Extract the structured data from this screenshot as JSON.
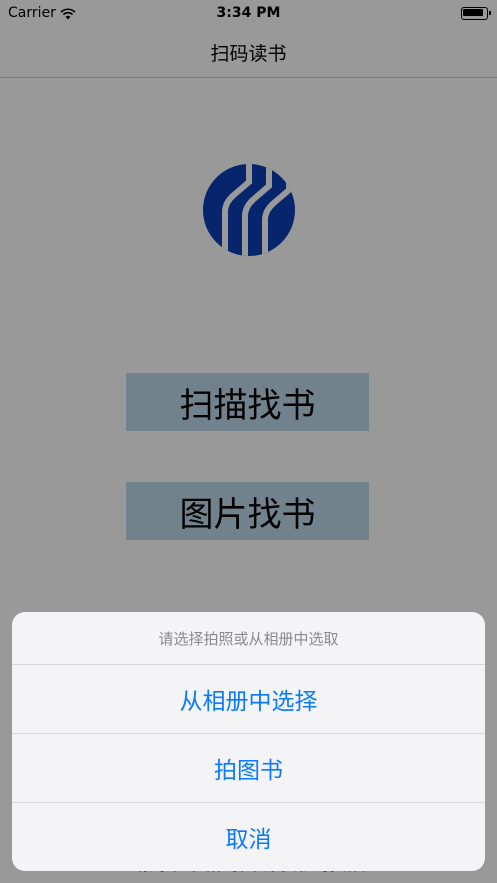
{
  "status_bar": {
    "carrier": "Carrier",
    "time": "3:34 PM"
  },
  "nav": {
    "title": "扫码读书"
  },
  "main": {
    "scan_button_label": "扫描找书",
    "photo_button_label": "图片找书",
    "footnote": "…请对准书籍封面或条形码扫描…"
  },
  "action_sheet": {
    "message": "请选择拍照或从相册中选取",
    "options": [
      "从相册中选择",
      "拍图书",
      "取消"
    ]
  },
  "colors": {
    "accent": "#0a7aff",
    "button_bg": "#bed9ec",
    "logo_blue": "#0b3fb5"
  }
}
